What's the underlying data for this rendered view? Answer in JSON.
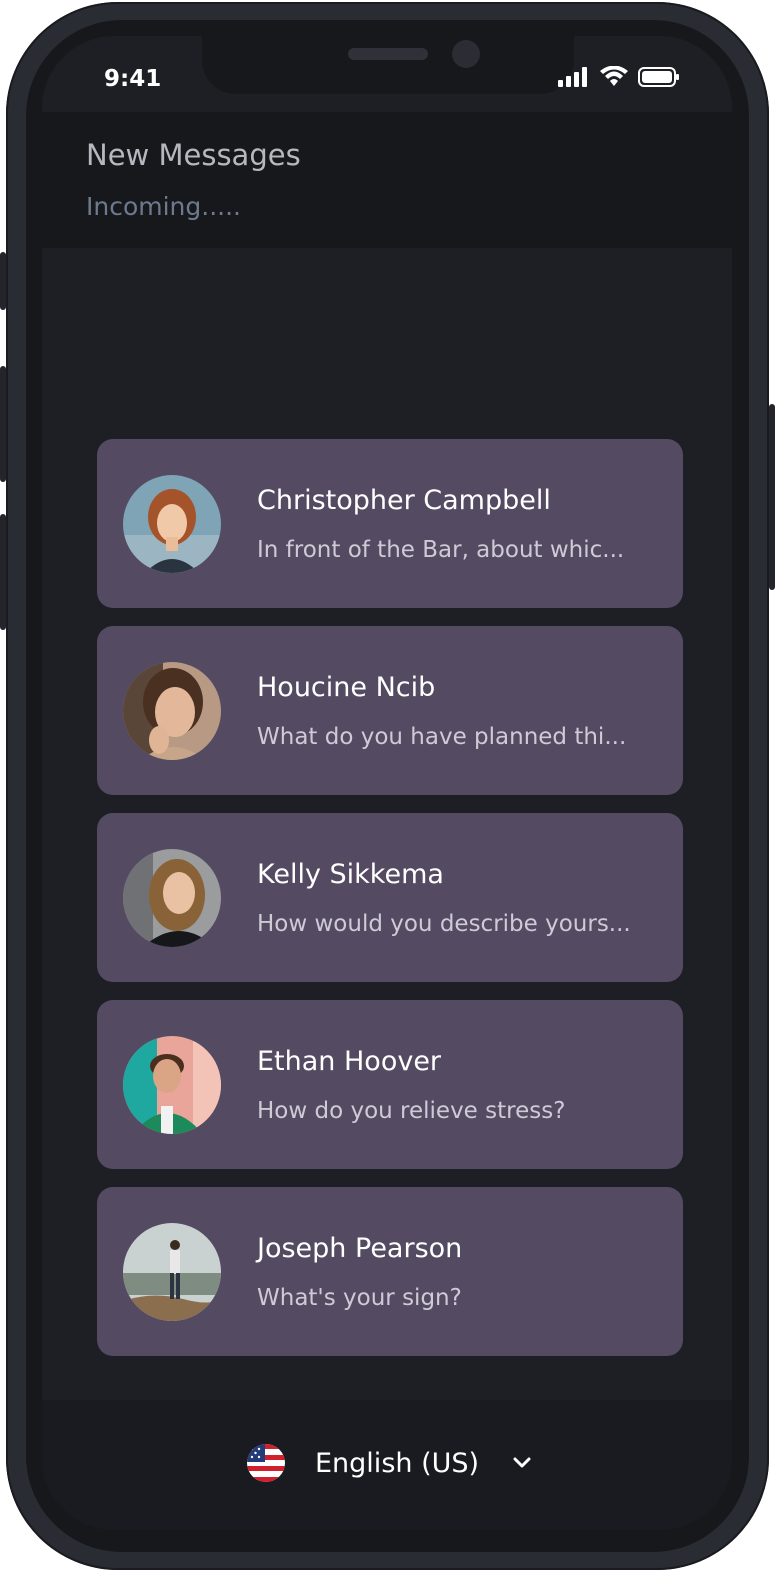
{
  "status": {
    "time": "9:41"
  },
  "header": {
    "title": "New Messages",
    "subtitle": "Incoming....."
  },
  "messages": [
    {
      "name": "Christopher Campbell",
      "preview": "In front of the Bar, about whic..."
    },
    {
      "name": "Houcine Ncib",
      "preview": "What do you have planned thi..."
    },
    {
      "name": "Kelly Sikkema",
      "preview": "How would you describe yours..."
    },
    {
      "name": "Ethan Hoover",
      "preview": "How do you relieve stress?"
    },
    {
      "name": "Joseph Pearson",
      "preview": "What's your sign?"
    }
  ],
  "footer": {
    "language": "English (US)",
    "flag_icon": "us-flag-icon",
    "chevron_icon": "chevron-down-icon"
  },
  "colors": {
    "card": "#544b63",
    "screen": "#1e1f24",
    "header": "#17181c"
  }
}
